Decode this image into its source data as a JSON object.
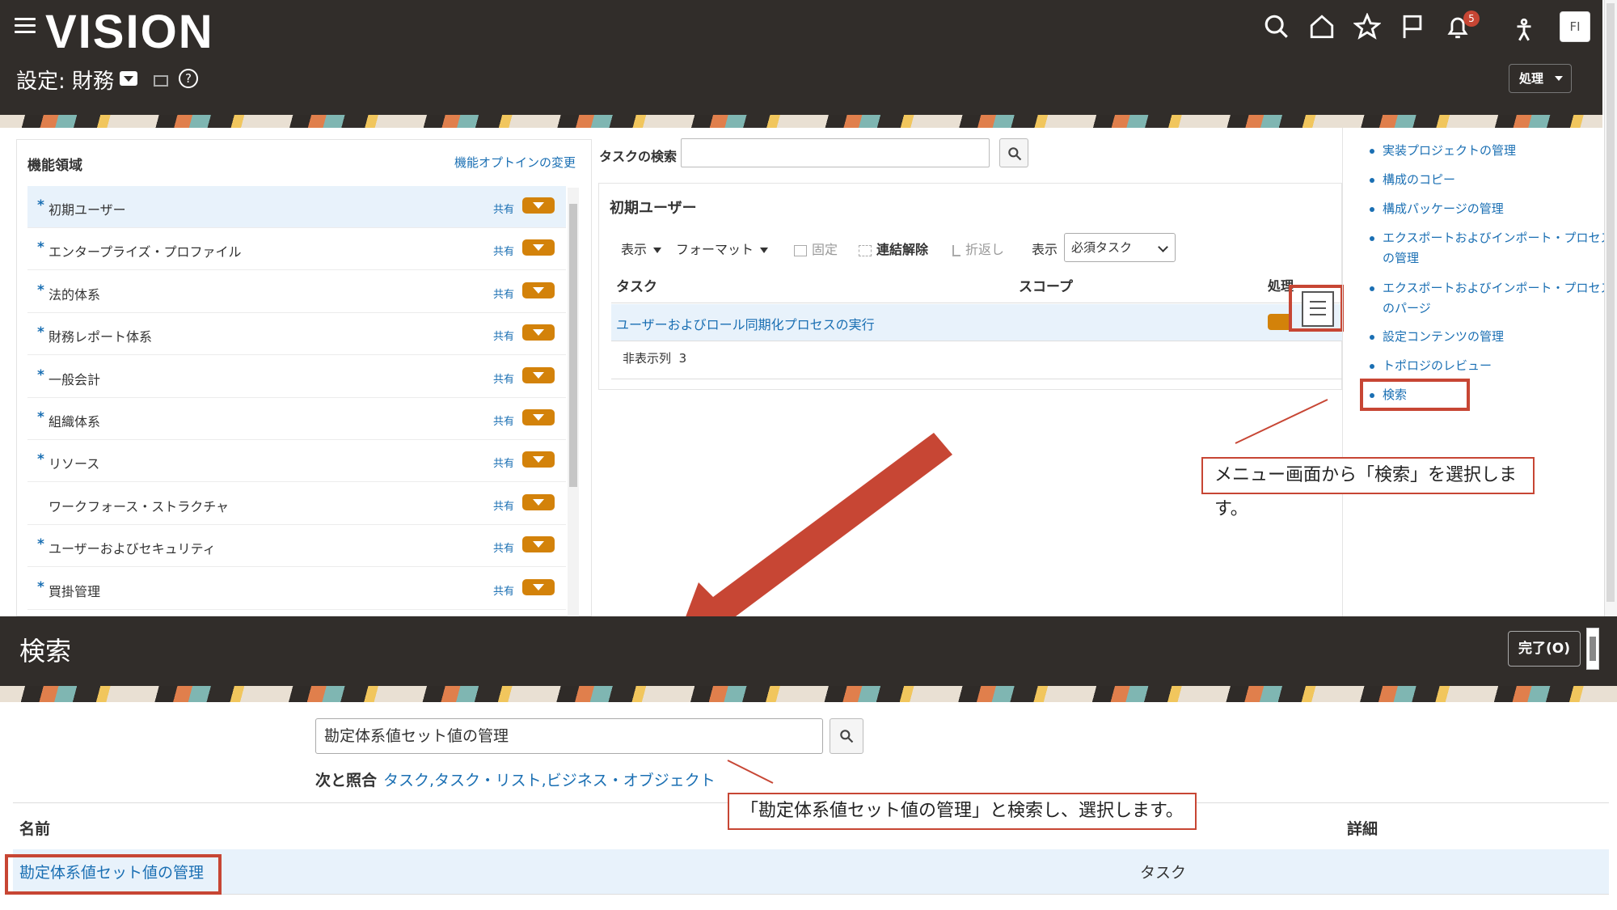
{
  "header": {
    "logo": "VISION",
    "page_title": "設定: 財務",
    "help": "?",
    "notification_count": "5",
    "avatar_initials": "FI",
    "actions_label": "処理"
  },
  "functional_areas": {
    "title": "機能領域",
    "change_optin_link": "機能オプトインの変更",
    "shared_label": "共有",
    "items": [
      {
        "label": "初期ユーザー",
        "required": true,
        "selected": true
      },
      {
        "label": "エンタープライズ・プロファイル",
        "required": true
      },
      {
        "label": "法的体系",
        "required": true
      },
      {
        "label": "財務レポート体系",
        "required": true
      },
      {
        "label": "一般会計",
        "required": true
      },
      {
        "label": "組織体系",
        "required": true
      },
      {
        "label": "リソース",
        "required": true
      },
      {
        "label": "ワークフォース・ストラクチャ",
        "required": false
      },
      {
        "label": "ユーザーおよびセキュリティ",
        "required": true
      },
      {
        "label": "買掛管理",
        "required": true
      }
    ]
  },
  "task_search": {
    "label": "タスクの検索",
    "value": ""
  },
  "task_panel": {
    "title": "初期ユーザー",
    "toolbar": {
      "view": "表示",
      "format": "フォーマット",
      "freeze": "固定",
      "detach": "連結解除",
      "wrap": "折返し",
      "show_label": "表示",
      "show_value": "必須タスク"
    },
    "columns": {
      "task": "タスク",
      "scope": "スコープ",
      "actions": "処理"
    },
    "rows": [
      {
        "task": "ユーザーおよびロール同期化プロセスの実行"
      }
    ],
    "hidden_columns_label": "非表示列",
    "hidden_columns_count": "3"
  },
  "right_rail": {
    "items": [
      "実装プロジェクトの管理",
      "構成のコピー",
      "構成パッケージの管理",
      "エクスポートおよびインポート・プロセスの管理",
      "エクスポートおよびインポート・プロセスのパージ",
      "設定コンテンツの管理",
      "トポロジのレビュー",
      "検索"
    ]
  },
  "annotations": {
    "callout_menu": "メニュー画面から「検索」を選択します。",
    "callout_search": "「勘定体系値セット値の管理」と検索し、選択します。"
  },
  "search_panel": {
    "title": "検索",
    "done_label": "完了(O)",
    "query": "勘定体系値セット値の管理",
    "match_label": "次と照合",
    "match_types": "タスク,タスク・リスト,ビジネス・オブジェクト",
    "columns": {
      "name": "名前",
      "details": "詳細"
    },
    "results": [
      {
        "name": "勘定体系値セット値の管理",
        "type": "タスク"
      }
    ]
  },
  "colors": {
    "header_bg": "#312d2a",
    "link": "#1a6fb3",
    "accent_orange": "#d3820a",
    "annotation_red": "#c74634",
    "selected_row": "#e8f2fb"
  }
}
